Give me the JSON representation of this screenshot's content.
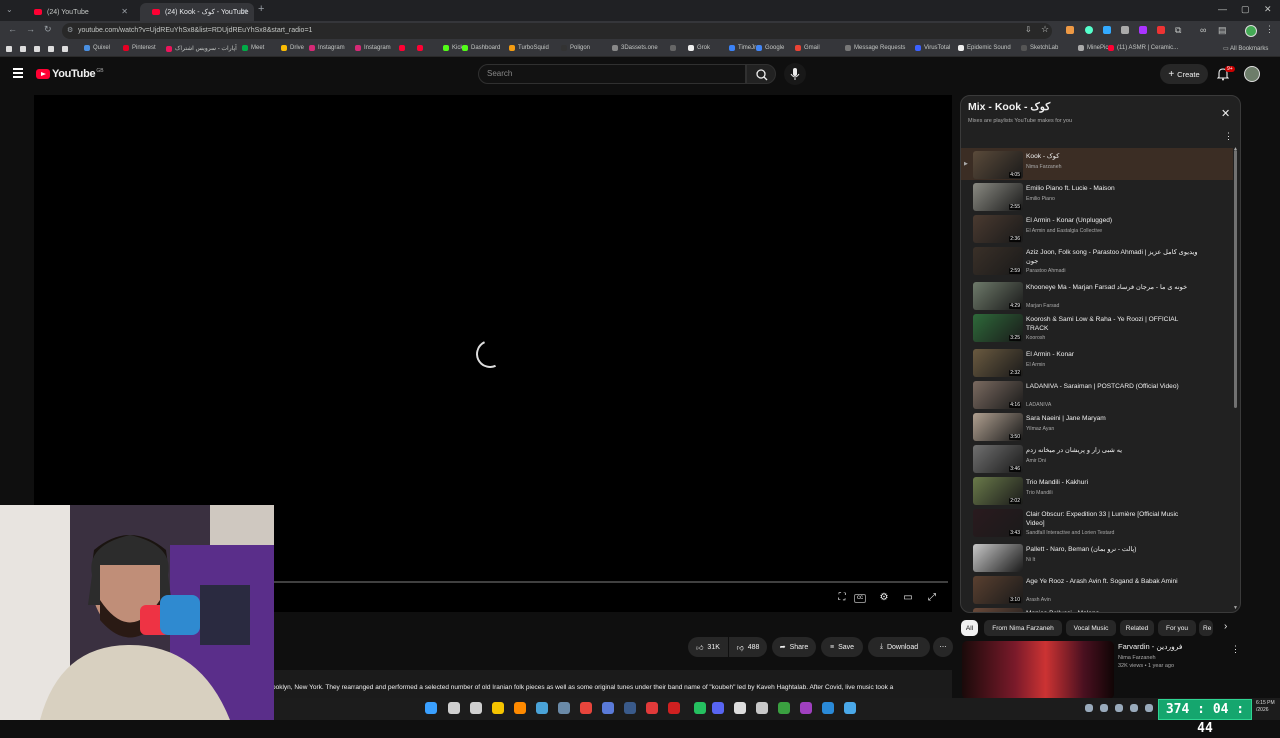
{
  "browser": {
    "tabs": [
      {
        "label": "(24) YouTube"
      },
      {
        "label": "(24) Kook - کوک - YouTube"
      }
    ],
    "url": "youtube.com/watch?v=UjdREuYhSx8&list=RDUjdREuYhSx8&start_radio=1",
    "bookmarks": [
      {
        "label": "Quixel",
        "color": "#4a90e2"
      },
      {
        "label": "Pinterest",
        "color": "#e60023"
      },
      {
        "label": "آپارات - سرویس اشتراک",
        "color": "#ed145b"
      },
      {
        "label": "Meet",
        "color": "#00ac47"
      },
      {
        "label": "Drive",
        "color": "#fbbc04"
      },
      {
        "label": "Instagram",
        "color": "#d62976"
      },
      {
        "label": "Instagram",
        "color": "#d62976"
      },
      {
        "label": "",
        "color": "#ff0033"
      },
      {
        "label": "",
        "color": "#ff0033"
      },
      {
        "label": "Kick",
        "color": "#53fc18"
      },
      {
        "label": "Dashboard",
        "color": "#53fc18"
      },
      {
        "label": "TurboSquid",
        "color": "#f39c12"
      },
      {
        "label": "Poligon",
        "color": "#333"
      },
      {
        "label": "3Dassets.one",
        "color": "#888"
      },
      {
        "label": "",
        "color": "#666"
      },
      {
        "label": "Grok",
        "color": "#eee"
      },
      {
        "label": "TimeJr",
        "color": "#3b82f6"
      },
      {
        "label": "Google",
        "color": "#4285f4"
      },
      {
        "label": "Gmail",
        "color": "#ea4335"
      },
      {
        "label": "Message Requests",
        "color": "#777"
      },
      {
        "label": "VirusTotal",
        "color": "#3b61ff"
      },
      {
        "label": "Epidemic Sound",
        "color": "#eee"
      },
      {
        "label": "SketchLab",
        "color": "#555"
      },
      {
        "label": "MinePic",
        "color": "#aaa"
      },
      {
        "label": "(11) ASMR | Ceramic...",
        "color": "#ff0033"
      }
    ],
    "all_bookmarks": "All Bookmarks"
  },
  "youtube": {
    "logo_text": "YouTube",
    "region": "GB",
    "search_placeholder": "Search",
    "create_label": "Create",
    "notifications": "9+"
  },
  "actions": {
    "likes": "31K",
    "dislikes": "488",
    "share": "Share",
    "save": "Save",
    "download": "Download"
  },
  "description": "ooklyn, New York. They rearranged and performed a selected number of old Iranian folk pieces as well as some original tunes under their band name of \"koubeh\" led by Kaveh Haghtalab. After Covid, live music took a",
  "playlist": {
    "title": "Mix - Kook - کوک",
    "subtitle": "Mixes are playlists YouTube makes for you",
    "items": [
      {
        "title": "Kook - کوک",
        "channel": "Nima Farzaneh",
        "duration": "4:05",
        "thumb": "#5a4a3a",
        "active": true
      },
      {
        "title": "Emilio Piano ft. Lucie - Maison",
        "channel": "Emilio Piano",
        "duration": "2:55",
        "thumb": "#8a8a82"
      },
      {
        "title": "El Armin - Konar (Unplugged)",
        "channel": "El Armin and Eastalgia Collective",
        "duration": "2:36",
        "thumb": "#4a3a30"
      },
      {
        "title": "Aziz Joon, Folk song - Parastoo Ahmadi | ویدیوی کامل عزیز جون",
        "channel": "Parastoo Ahmadi",
        "duration": "2:59",
        "thumb": "#3a3028"
      },
      {
        "title": "Khooneye Ma - Marjan Farsad خونه ی ما - مرجان فرساد",
        "channel": "Marjan Farsad",
        "duration": "4:29",
        "thumb": "#6e7a6a"
      },
      {
        "title": "Koorosh & Sami Low & Raha - Ye Roozi | OFFICIAL TRACK",
        "channel": "Koorosh",
        "duration": "3:25",
        "thumb": "#2e6a3a"
      },
      {
        "title": "El Armin - Konar",
        "channel": "El Armin",
        "duration": "2:32",
        "thumb": "#6a5a40"
      },
      {
        "title": "LADANIVA - Saraiman | POSTCARD (Official Video)",
        "channel": "LADANIVA",
        "duration": "4:16",
        "thumb": "#7a6a60"
      },
      {
        "title": "Sara Naeini | Jane Maryam",
        "channel": "Yilmaz Ayan",
        "duration": "3:50",
        "thumb": "#b0a090"
      },
      {
        "title": "یه شبی زار و پریشان در میخانه زدم",
        "channel": "Amir Dni",
        "duration": "3:46",
        "thumb": "#707070"
      },
      {
        "title": "Trio Mandili - Kakhuri",
        "channel": "Trio Mandili",
        "duration": "2:02",
        "thumb": "#6a7a4a"
      },
      {
        "title": "Clair Obscur: Expedition 33 | Lumière [Official Music Video]",
        "channel": "Sandfall Interactive and Lorien Testard",
        "duration": "3:43",
        "thumb": "#2a1a1e"
      },
      {
        "title": "Pallett - Naro, Beman (پالت - نرو بمان)",
        "channel": "Ni It",
        "duration": "",
        "thumb": "#c8c8c8"
      },
      {
        "title": "Age Ye Rooz - Arash Avin ft. Sogand & Babak Amini",
        "channel": "Arash Avin",
        "duration": "3:10",
        "thumb": "#5a4030"
      },
      {
        "title": "Monica Bellucci - Malena",
        "channel": "",
        "duration": "",
        "thumb": "#6a4a3a"
      }
    ]
  },
  "chips": [
    "All",
    "From Nima Farzaneh",
    "Vocal Music",
    "Related",
    "For you",
    "Re"
  ],
  "related": {
    "title": "Farvardin - فروردین",
    "channel": "Nima Farzaneh",
    "meta": "32K views • 1 year ago"
  },
  "overlay": {
    "timer": "374 : 04 : 44",
    "clock_time": "6:15 PM",
    "clock_date": "/2026"
  }
}
